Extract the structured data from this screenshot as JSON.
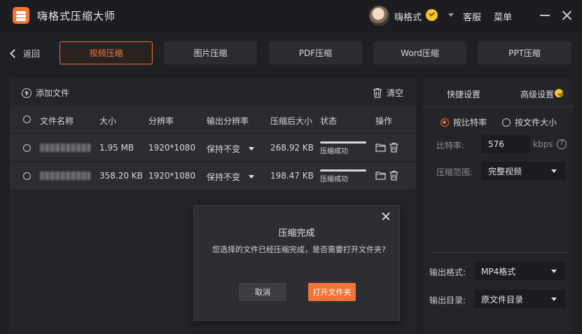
{
  "app": {
    "title": "嗨格式压缩大师"
  },
  "header": {
    "username": "嗨格式",
    "service": "客服",
    "menu": "菜单"
  },
  "nav": {
    "back": "返回",
    "tabs": [
      "视频压缩",
      "图片压缩",
      "PDF压缩",
      "Word压缩",
      "PPT压缩"
    ],
    "active_tab": "视频压缩"
  },
  "file_panel": {
    "add_file": "添加文件",
    "clear": "清空",
    "columns": [
      "文件名称",
      "大小",
      "分辨率",
      "输出分辨率",
      "压缩后大小",
      "状态",
      "操作"
    ],
    "rows": [
      {
        "size": "1.95 MB",
        "resolution": "1920*1080",
        "output_resolution": "保持不变",
        "compressed_size": "268.92 KB",
        "status": "压缩成功"
      },
      {
        "size": "358.20 KB",
        "resolution": "1920*1080",
        "output_resolution": "保持不变",
        "compressed_size": "198.47 KB",
        "status": "压缩成功"
      }
    ]
  },
  "settings": {
    "tabs": [
      "快捷设置",
      "高级设置"
    ],
    "active_tab": "高级设置",
    "mode_options": [
      "按比特率",
      "按文件大小"
    ],
    "selected_mode": "按比特率",
    "bitrate_label": "比特率:",
    "bitrate_value": "576",
    "bitrate_unit": "kbps",
    "range_label": "压缩范围:",
    "range_value": "完整视频",
    "format_label": "输出格式:",
    "format_value": "MP4格式",
    "dir_label": "输出目录:",
    "dir_value": "原文件目录"
  },
  "dialog": {
    "title": "压缩完成",
    "message": "您选择的文件已经压缩完成，是否需要打开文件夹?",
    "cancel": "取消",
    "open_folder": "打开文件夹"
  },
  "colors": {
    "accent": "#f07337",
    "bg": "#1f2024",
    "panel": "#242529",
    "vip": "#f5c42d"
  }
}
